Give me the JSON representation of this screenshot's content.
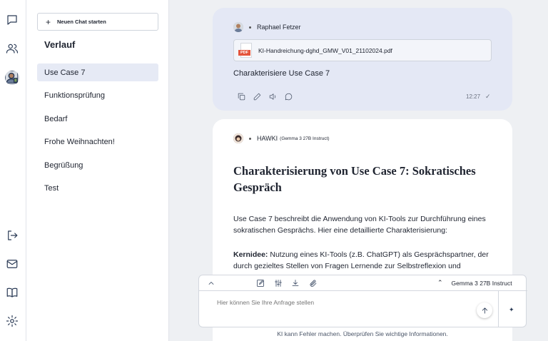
{
  "rail": {
    "icons": [
      "chat-icon",
      "users-icon",
      "avatar",
      "logout-icon",
      "mail-icon",
      "book-icon",
      "settings-icon"
    ]
  },
  "sidebar": {
    "new_chat_label": "Neuen Chat starten",
    "history_title": "Verlauf",
    "items": [
      {
        "label": "Use Case 7",
        "active": true
      },
      {
        "label": "Funktionsprüfung"
      },
      {
        "label": "Bedarf"
      },
      {
        "label": "Frohe Weihnachten!"
      },
      {
        "label": "Begrüßung"
      },
      {
        "label": "Test"
      }
    ]
  },
  "user_message": {
    "author": "Raphael Fetzer",
    "attachment": "KI-Handreichung-dghd_GMW_V01_21102024.pdf",
    "attachment_type": "PDF",
    "text": "Charakterisiere Use Case 7",
    "time": "12:27"
  },
  "bot_message": {
    "author": "HAWKI",
    "model": "(Gemma 3 27B Instruct)",
    "title": "Charakterisierung von Use Case 7: Sokratisches Gespräch",
    "p1": "Use Case 7 beschreibt die Anwendung von KI-Tools zur Durchführung eines sokratischen Gesprächs. Hier eine detaillierte Charakterisierung:",
    "p2_label": "Kernidee:",
    "p2_text": " Nutzung eines KI-Tools (z.B. ChatGPT) als Gesprächspartner, der durch gezieltes Stellen von Fragen Lernende zur Selbstreflexion und"
  },
  "composer": {
    "model_name": "Gemma 3 27B Instruct",
    "placeholder": "Hier können Sie Ihre Anfrage stellen"
  },
  "disclaimer": "KI kann Fehler machen. Überprüfen Sie wichtige Informationen.",
  "colors": {
    "accent_bg": "#e4e8f5",
    "active_item": "#e6eaf5",
    "pdf_red": "#e4543c"
  }
}
